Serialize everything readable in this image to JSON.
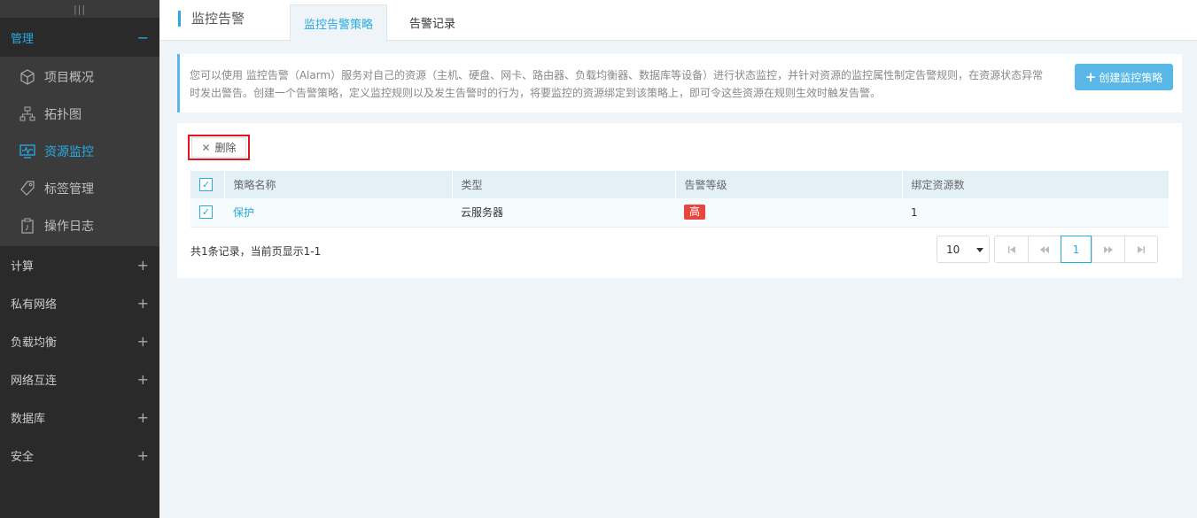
{
  "sidebar": {
    "handle": "|||",
    "active_group": {
      "label": "管理",
      "toggle": "−"
    },
    "sub_items": [
      {
        "label": "项目概况",
        "icon": "cube-icon"
      },
      {
        "label": "拓扑图",
        "icon": "topology-icon"
      },
      {
        "label": "资源监控",
        "icon": "monitor-icon",
        "active": true
      },
      {
        "label": "标签管理",
        "icon": "tag-icon"
      },
      {
        "label": "操作日志",
        "icon": "clipboard-icon"
      }
    ],
    "groups": [
      {
        "label": "计算",
        "toggle": "+"
      },
      {
        "label": "私有网络",
        "toggle": "+"
      },
      {
        "label": "负载均衡",
        "toggle": "+"
      },
      {
        "label": "网络互连",
        "toggle": "+"
      },
      {
        "label": "数据库",
        "toggle": "+"
      },
      {
        "label": "安全",
        "toggle": "+"
      }
    ]
  },
  "header": {
    "title": "监控告警",
    "tabs": [
      {
        "label": "监控告警策略",
        "active": true
      },
      {
        "label": "告警记录",
        "active": false
      }
    ]
  },
  "info": {
    "text": "您可以使用 监控告警（Alarm）服务对自己的资源（主机、硬盘、网卡、路由器、负载均衡器、数据库等设备）进行状态监控，并针对资源的监控属性制定告警规则，在资源状态异常时发出警告。创建一个告警策略，定义监控规则以及发生告警时的行为，将要监控的资源绑定到该策略上，即可令这些资源在规则生效时触发告警。",
    "create_button": "创建监控策略"
  },
  "toolbar": {
    "delete_label": "删除"
  },
  "table": {
    "headers": [
      "策略名称",
      "类型",
      "告警等级",
      "绑定资源数"
    ],
    "rows": [
      {
        "name": "保护",
        "type": "云服务器",
        "level": "高",
        "bound": "1"
      }
    ]
  },
  "footer": {
    "summary": "共1条记录，当前页显示1-1",
    "page_size": "10",
    "current_page": "1"
  },
  "colors": {
    "accent": "#29abe2",
    "danger": "#e8473f",
    "sidebar_bg": "#2a2a2a"
  }
}
